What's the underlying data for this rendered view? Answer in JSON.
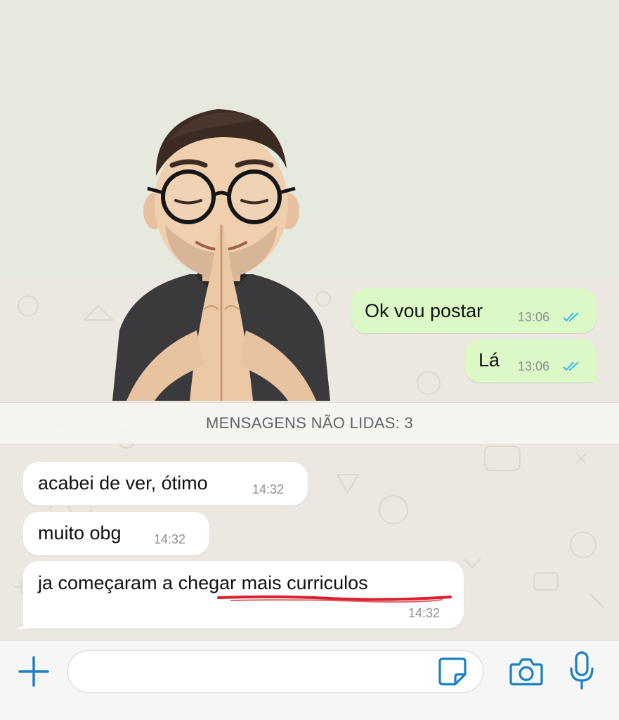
{
  "chat": {
    "outgoing": [
      {
        "text": "Ok vou postar",
        "time": "13:06",
        "status": "read"
      },
      {
        "text": "Lá",
        "time": "13:06",
        "status": "read"
      }
    ],
    "unread_divider": "MENSAGENS NÃO LIDAS: 3",
    "incoming": [
      {
        "text": "acabei de ver, ótimo",
        "time": "14:32"
      },
      {
        "text": "muito obg",
        "time": "14:32"
      },
      {
        "text": "ja começaram a chegar mais curriculos",
        "time": "14:32"
      }
    ],
    "sticker": {
      "icon": "praying-memoji-sticker"
    }
  },
  "input_bar": {
    "message_value": "",
    "icons": {
      "attach": "plus-icon",
      "sticker": "sticker-icon",
      "camera": "camera-icon",
      "microphone": "microphone-icon"
    }
  },
  "colors": {
    "outgoing_bubble": "#dcf8c6",
    "incoming_bubble": "#ffffff",
    "read_ticks": "#34b7f1",
    "accent": "#1c7fc2",
    "annotation_underline": "#d8202e"
  }
}
